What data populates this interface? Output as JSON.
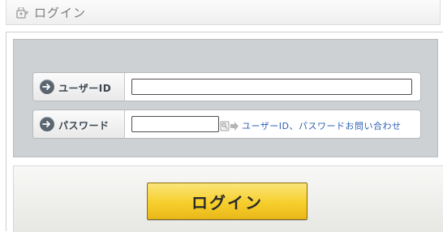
{
  "header": {
    "title": "ログイン",
    "icon": "key-lock-icon"
  },
  "form": {
    "user_id": {
      "label": "ユーザーID",
      "value": "",
      "icon": "arrow-circle-icon"
    },
    "password": {
      "label": "パスワード",
      "value": "",
      "icon": "arrow-circle-icon",
      "help_icon": "key-arrow-icon",
      "help_link": "ユーザーID、パスワードお問い合わせ"
    }
  },
  "login_button": {
    "label": "ログイン"
  },
  "colors": {
    "panel_background": "#cdd1d4",
    "button_yellow": "#f6cf2c",
    "link_blue": "#2f62b4"
  }
}
